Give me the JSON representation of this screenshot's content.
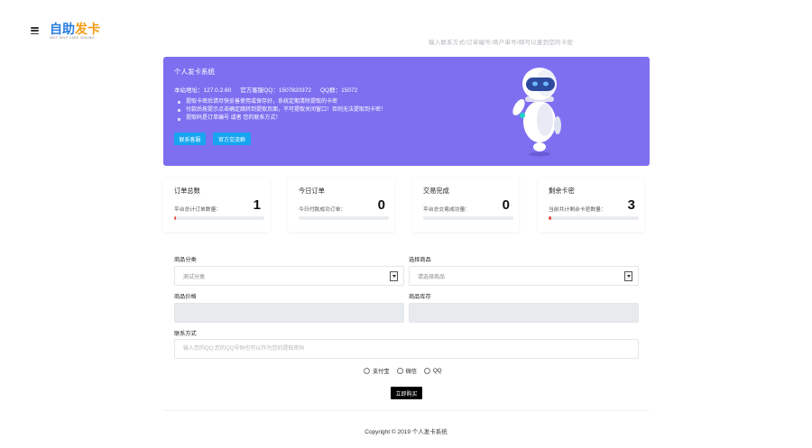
{
  "header": {
    "logo_text_a": "自助",
    "logo_text_b": "发卡",
    "logo_sub": "SELF HELP CARD ISSUING",
    "search_hint": "输入联系方式/订单编号/商户单号/邮可以查到您的卡密"
  },
  "banner": {
    "title": "个人发卡系统",
    "site": "本站地址：127.0.2.60",
    "qq_service": "官方客服QQ：1507820372",
    "qq_group": "QQ群：15072",
    "notes": [
      "提取卡密后请尽快妥善使用或保存好，系统定期清除提取的卡密",
      "付款后按提示点击确定跳转到提取页面，不可提取关闭窗口！否则无法提取到卡密！",
      "提取码是订单编号 或者 您的联系方式！"
    ],
    "btn_service": "联系客服",
    "btn_group": "官方交流群"
  },
  "stats": [
    {
      "title": "订单总数",
      "desc": "平台总计订单数量：",
      "value": "1",
      "progress": 0.02
    },
    {
      "title": "今日订单",
      "desc": "今日付款成功订单：",
      "value": "0",
      "progress": 0
    },
    {
      "title": "交易完成",
      "desc": "平台总交易成功量：",
      "value": "0",
      "progress": 0
    },
    {
      "title": "剩余卡密",
      "desc": "当前共计剩余卡密数量：",
      "value": "3",
      "progress": 0.03
    }
  ],
  "form": {
    "category_label": "商品分类",
    "category_value": "测试分类",
    "product_label": "选择商品",
    "product_value": "请选择商品",
    "price_label": "商品价格",
    "stock_label": "商品库存",
    "contact_label": "联系方式",
    "contact_placeholder": "输入您的QQ,您的QQ号码也可以作为您的提取密码",
    "payments": [
      "支付宝",
      "微信",
      "QQ"
    ],
    "buy_label": "立即购买"
  },
  "footer": {
    "copyright": "Copyright © 2019 个人发卡系统"
  },
  "colors": {
    "banner": "#7e6ff0",
    "button": "#17a5ef",
    "progress": "#e74c3c"
  }
}
